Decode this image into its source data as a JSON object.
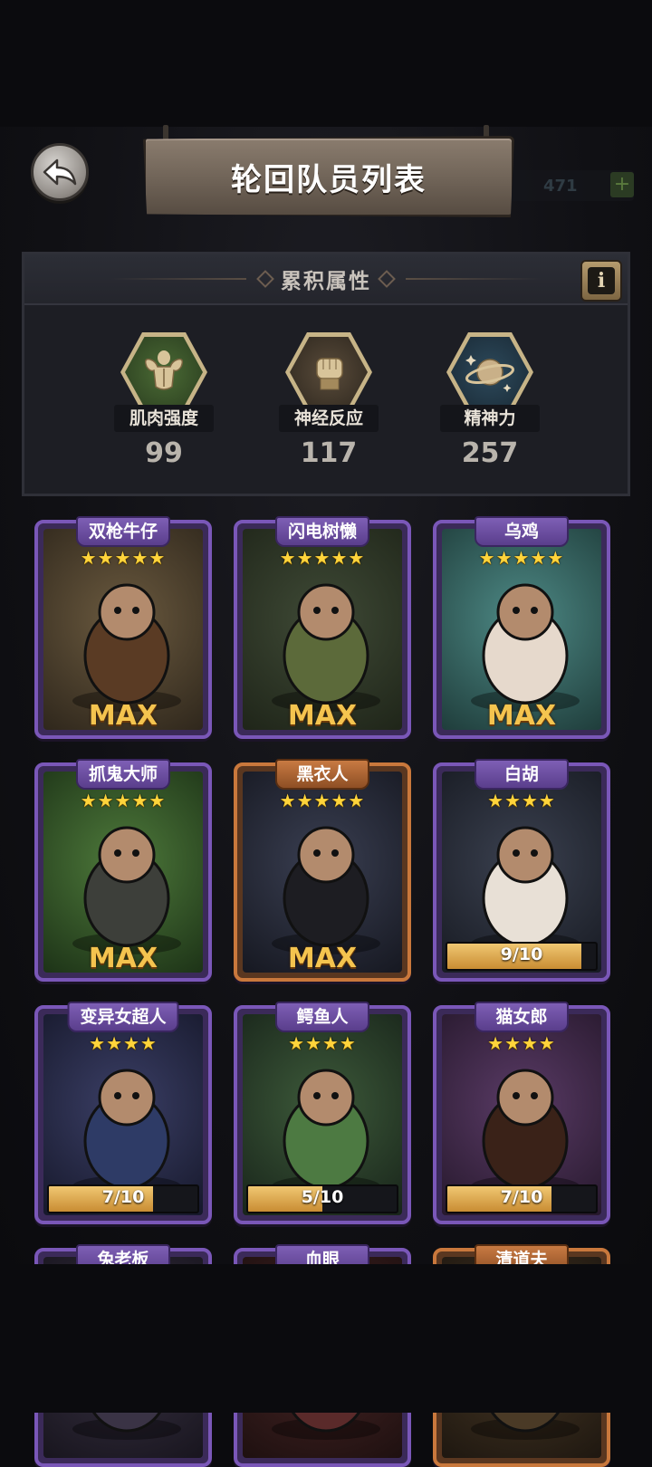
{
  "header": {
    "title": "轮回队员列表",
    "currency_ghost": "471"
  },
  "attributes": {
    "title": "累积属性",
    "stats": [
      {
        "label": "肌肉强度",
        "value": "99",
        "icon": "muscle-icon"
      },
      {
        "label": "神经反应",
        "value": "117",
        "icon": "fist-icon"
      },
      {
        "label": "精神力",
        "value": "257",
        "icon": "planet-icon"
      }
    ]
  },
  "characters": [
    {
      "name": "双枪牛仔",
      "stars": "★★★★★",
      "status": "MAX",
      "progress": null,
      "rarity": "purple"
    },
    {
      "name": "闪电树懒",
      "stars": "★★★★★",
      "status": "MAX",
      "progress": null,
      "rarity": "purple"
    },
    {
      "name": "乌鸡",
      "stars": "★★★★★",
      "status": "MAX",
      "progress": null,
      "rarity": "purple"
    },
    {
      "name": "抓鬼大师",
      "stars": "★★★★★",
      "status": "MAX",
      "progress": null,
      "rarity": "purple"
    },
    {
      "name": "黑衣人",
      "stars": "★★★★★",
      "status": "MAX",
      "progress": null,
      "rarity": "orange"
    },
    {
      "name": "白胡",
      "stars": "★★★★",
      "status": "9/10",
      "progress": 0.9,
      "rarity": "purple"
    },
    {
      "name": "变异女超人",
      "stars": "★★★★",
      "status": "7/10",
      "progress": 0.7,
      "rarity": "purple"
    },
    {
      "name": "鳄鱼人",
      "stars": "★★★★",
      "status": "5/10",
      "progress": 0.5,
      "rarity": "purple"
    },
    {
      "name": "猫女郎",
      "stars": "★★★★",
      "status": "7/10",
      "progress": 0.7,
      "rarity": "purple"
    },
    {
      "name": "兔老板",
      "stars": "",
      "status": "",
      "progress": null,
      "rarity": "purple"
    },
    {
      "name": "血眼",
      "stars": "",
      "status": "",
      "progress": null,
      "rarity": "purple"
    },
    {
      "name": "清道夫",
      "stars": "",
      "status": "",
      "progress": null,
      "rarity": "orange"
    }
  ],
  "colors": {
    "purple_frame": "#7a57b8",
    "orange_frame": "#c9783c",
    "star": "#ffd43b",
    "max": "#f4c44f"
  }
}
